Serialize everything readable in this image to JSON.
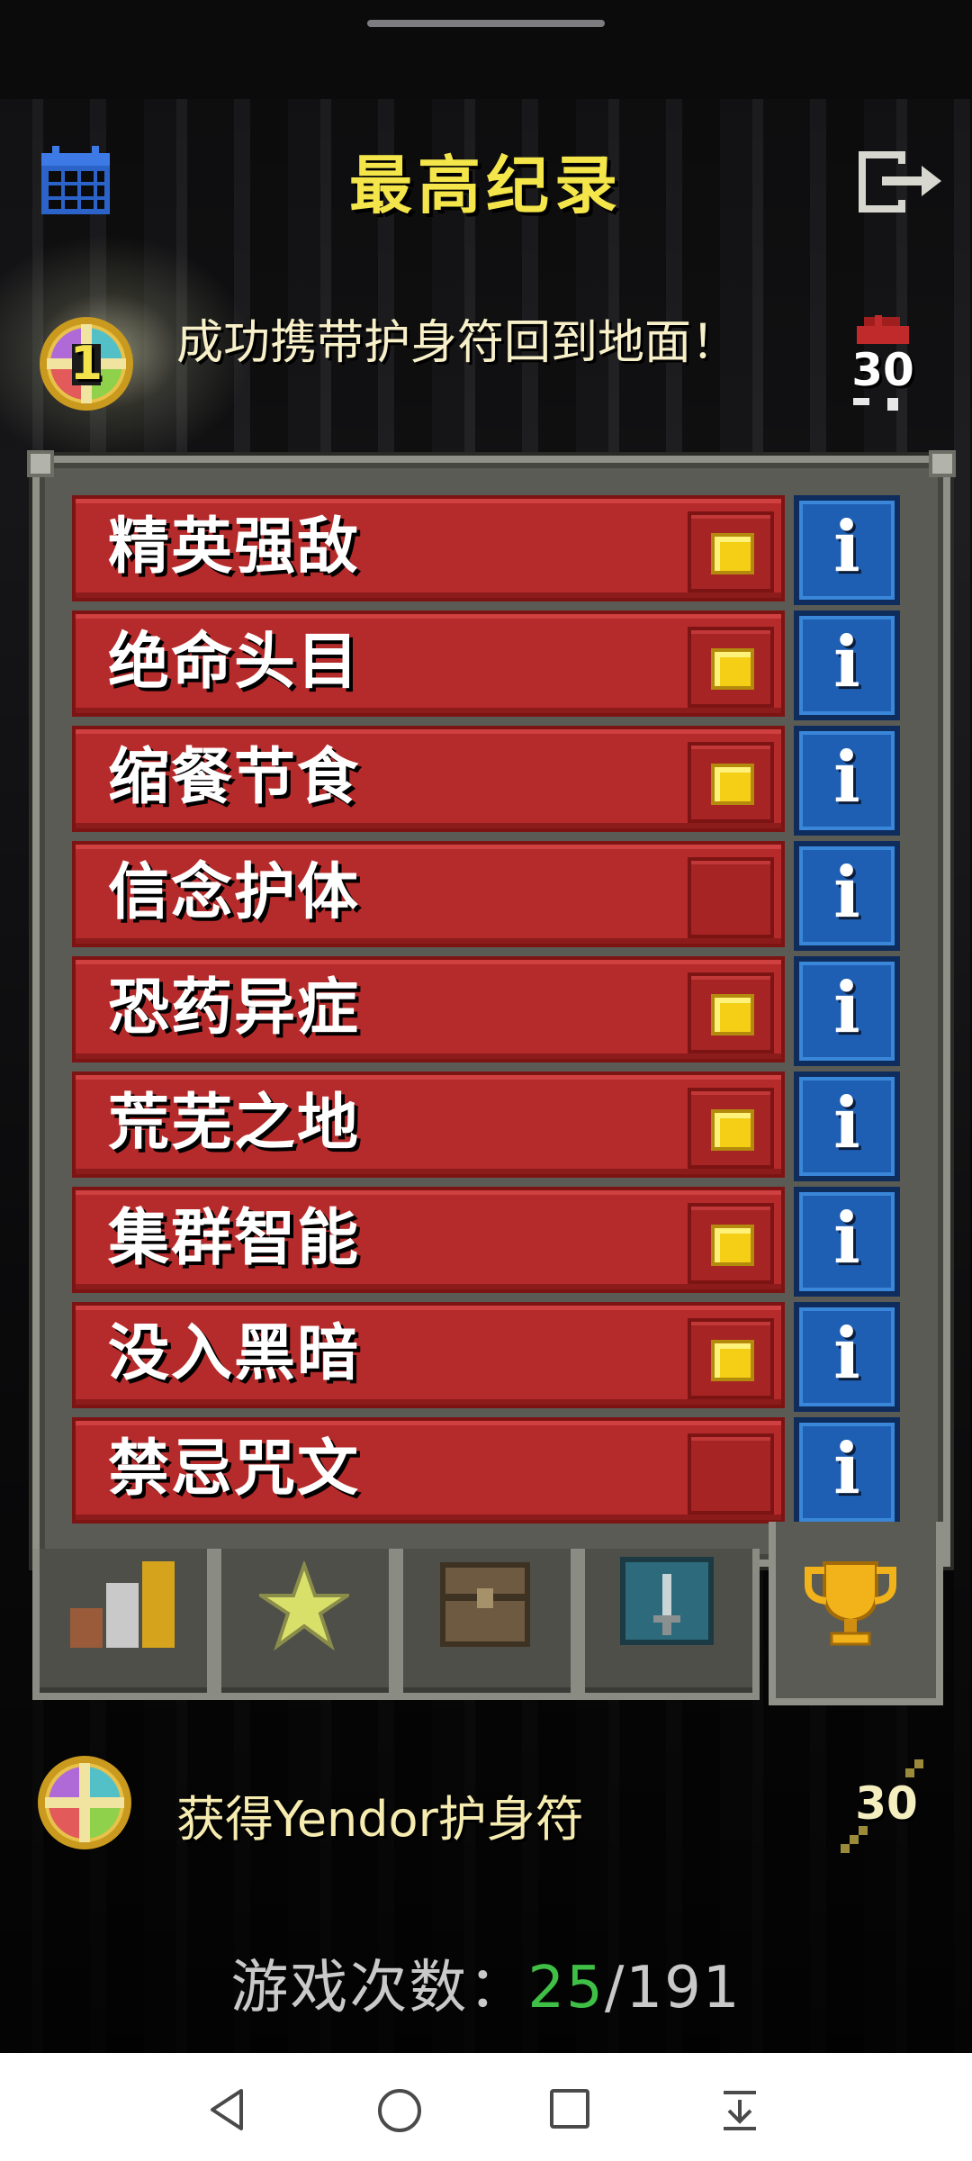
{
  "title": "最高纪录",
  "record": {
    "rank": "1",
    "description": "成功携带护身符回到地面！",
    "depth": "30"
  },
  "challenges": [
    {
      "label": "精英强敌",
      "checked": true
    },
    {
      "label": "绝命头目",
      "checked": true
    },
    {
      "label": "缩餐节食",
      "checked": true
    },
    {
      "label": "信念护体",
      "checked": false
    },
    {
      "label": "恐药异症",
      "checked": true
    },
    {
      "label": "荒芜之地",
      "checked": true
    },
    {
      "label": "集群智能",
      "checked": true
    },
    {
      "label": "没入黑暗",
      "checked": true
    },
    {
      "label": "禁忌咒文",
      "checked": false
    }
  ],
  "info_glyph": "i",
  "tabs": [
    "stats-tab",
    "badges-tab",
    "journal-tab",
    "alchemy-tab",
    "rankings-tab"
  ],
  "amulet_record": {
    "text": "获得Yendor护身符",
    "depth": "30"
  },
  "games": {
    "label": "游戏次数：",
    "won": "25",
    "separator": "/",
    "total": "191"
  },
  "colors": {
    "title": "#f4e64a",
    "challenge_bg": "#b52a2a",
    "checkbox_on": "#f4cf16",
    "info_blue": "#1f5fb3",
    "won_green": "#3fbf45"
  },
  "icons": [
    "calendar-icon",
    "exit-icon",
    "info-icon",
    "trophy-icon",
    "back-icon",
    "home-icon",
    "recents-icon",
    "download-icon"
  ]
}
